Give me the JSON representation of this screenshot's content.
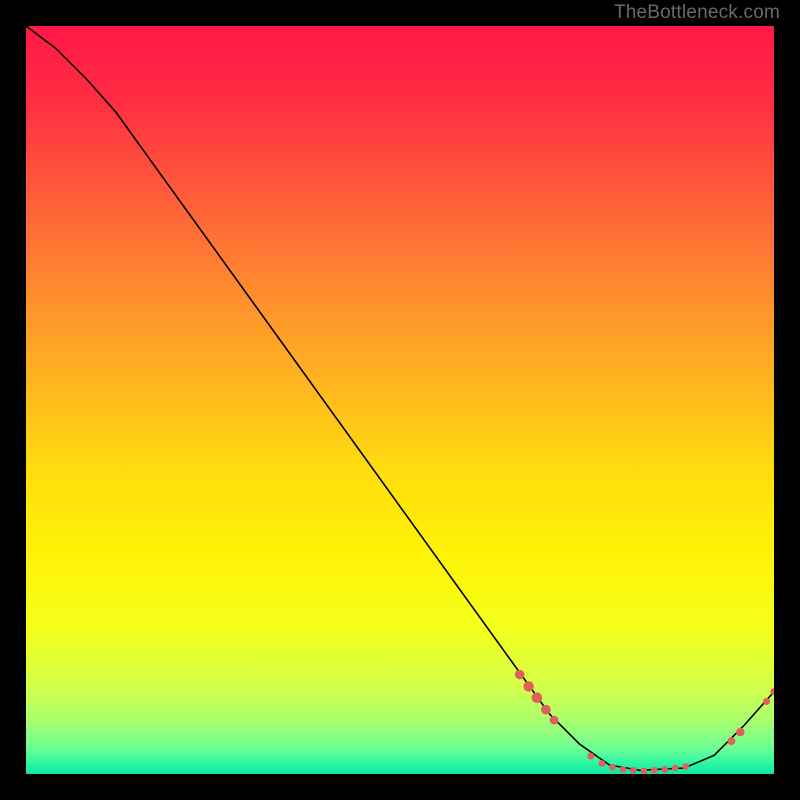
{
  "attribution": "TheBottleneck.com",
  "chart_data": {
    "type": "line",
    "title": "",
    "xlabel": "",
    "ylabel": "",
    "xlim": [
      0,
      100
    ],
    "ylim": [
      0,
      100
    ],
    "grid": false,
    "curve": [
      {
        "x": 0,
        "y": 100
      },
      {
        "x": 4,
        "y": 97
      },
      {
        "x": 8,
        "y": 93
      },
      {
        "x": 12,
        "y": 88.5
      },
      {
        "x": 70,
        "y": 8
      },
      {
        "x": 74,
        "y": 4
      },
      {
        "x": 78,
        "y": 1.2
      },
      {
        "x": 82,
        "y": 0.5
      },
      {
        "x": 88,
        "y": 0.8
      },
      {
        "x": 92,
        "y": 2.5
      },
      {
        "x": 96,
        "y": 6.5
      },
      {
        "x": 100,
        "y": 11
      }
    ],
    "dots": [
      {
        "x": 66,
        "y": 13.3,
        "r": 4.8
      },
      {
        "x": 67.2,
        "y": 11.7,
        "r": 5.2
      },
      {
        "x": 68.3,
        "y": 10.2,
        "r": 5.3
      },
      {
        "x": 69.5,
        "y": 8.6,
        "r": 4.8
      },
      {
        "x": 70.6,
        "y": 7.2,
        "r": 4.4
      },
      {
        "x": 75.5,
        "y": 2.4,
        "r": 3.4
      },
      {
        "x": 77.0,
        "y": 1.4,
        "r": 3.4
      },
      {
        "x": 78.4,
        "y": 0.9,
        "r": 3.4
      },
      {
        "x": 79.8,
        "y": 0.6,
        "r": 3.4
      },
      {
        "x": 81.2,
        "y": 0.5,
        "r": 3.4
      },
      {
        "x": 82.6,
        "y": 0.4,
        "r": 3.4
      },
      {
        "x": 84.0,
        "y": 0.5,
        "r": 3.4
      },
      {
        "x": 85.4,
        "y": 0.6,
        "r": 3.4
      },
      {
        "x": 86.8,
        "y": 0.8,
        "r": 3.4
      },
      {
        "x": 88.2,
        "y": 1.0,
        "r": 3.4
      },
      {
        "x": 94.3,
        "y": 4.4,
        "r": 4.0
      },
      {
        "x": 95.5,
        "y": 5.6,
        "r": 4.2
      },
      {
        "x": 99.0,
        "y": 9.7,
        "r": 3.6
      },
      {
        "x": 100,
        "y": 11.0,
        "r": 3.6
      }
    ],
    "gradient_stops": [
      {
        "offset": 0.0,
        "color": "#ff1846"
      },
      {
        "offset": 0.1,
        "color": "#ff2d43"
      },
      {
        "offset": 0.22,
        "color": "#ff5a3a"
      },
      {
        "offset": 0.35,
        "color": "#ff8a2f"
      },
      {
        "offset": 0.48,
        "color": "#ffb61f"
      },
      {
        "offset": 0.6,
        "color": "#ffde0e"
      },
      {
        "offset": 0.7,
        "color": "#fff205"
      },
      {
        "offset": 0.8,
        "color": "#f4ff1a"
      },
      {
        "offset": 0.88,
        "color": "#d6ff46"
      },
      {
        "offset": 0.93,
        "color": "#a8ff6e"
      },
      {
        "offset": 0.965,
        "color": "#6dff93"
      },
      {
        "offset": 0.985,
        "color": "#2ef7a3"
      },
      {
        "offset": 1.0,
        "color": "#0de8a0"
      }
    ],
    "dot_color": "#e06060",
    "curve_color": "#000000"
  }
}
